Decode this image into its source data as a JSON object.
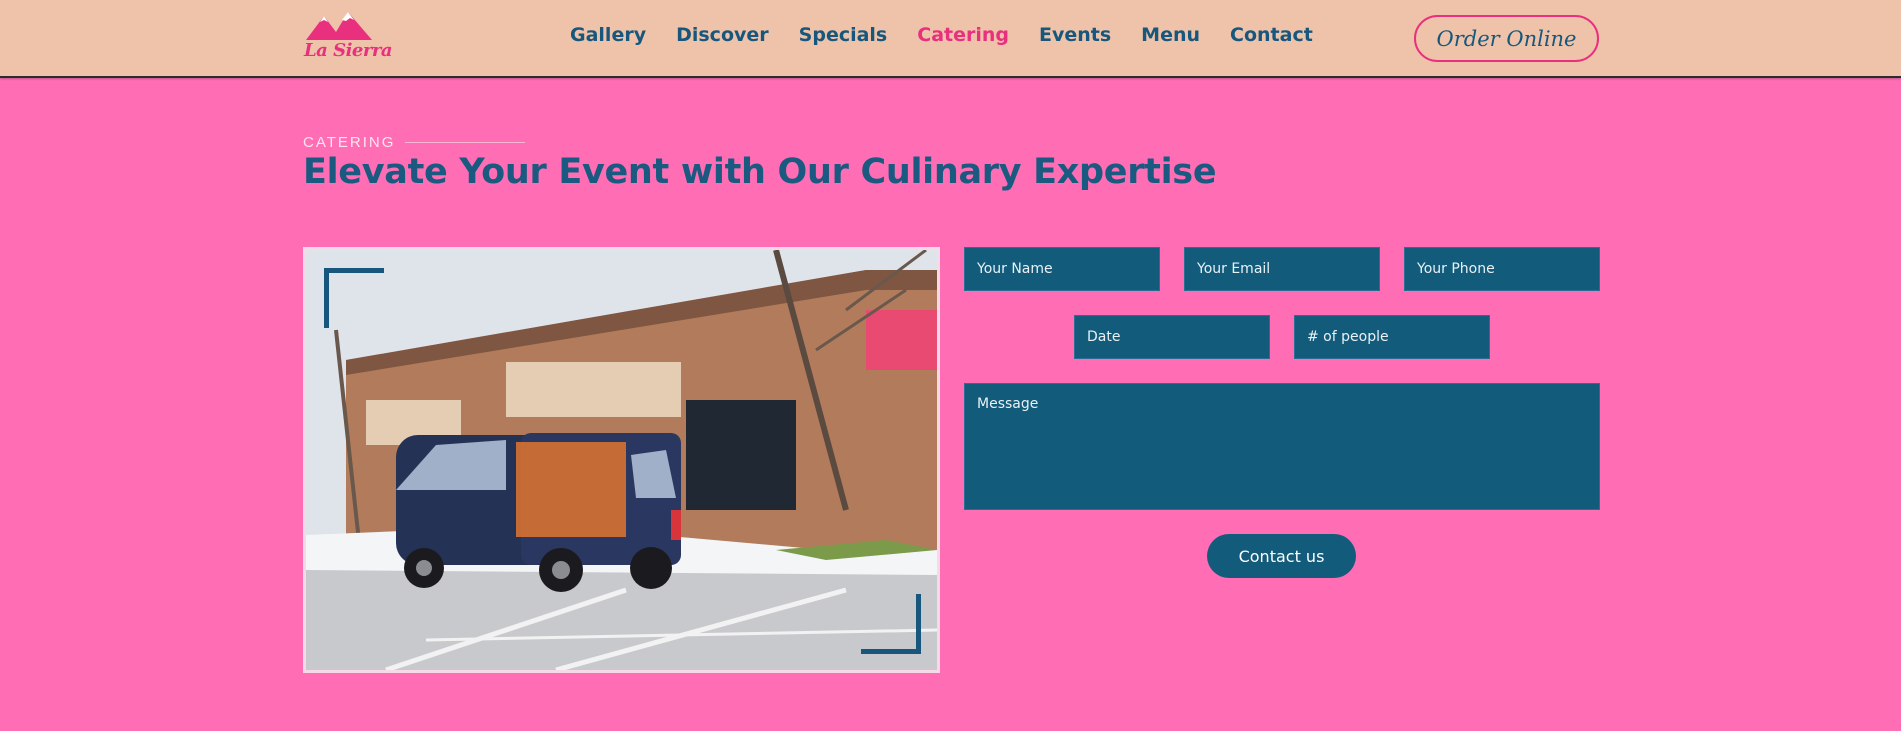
{
  "brand": {
    "logo_text": "La Sierra"
  },
  "nav": {
    "items": [
      {
        "label": "Gallery"
      },
      {
        "label": "Discover"
      },
      {
        "label": "Specials"
      },
      {
        "label": "Catering"
      },
      {
        "label": "Events"
      },
      {
        "label": "Menu"
      },
      {
        "label": "Contact"
      }
    ],
    "active": "Catering",
    "order_label": "Order Online"
  },
  "section": {
    "eyebrow": "CATERING",
    "headline": "Elevate Your Event with Our Culinary Expertise"
  },
  "form": {
    "name_placeholder": "Your Name",
    "email_placeholder": "Your Email",
    "phone_placeholder": "Your Phone",
    "date_placeholder": "Date",
    "people_placeholder": "# of people",
    "message_placeholder": "Message",
    "submit_label": "Contact us"
  },
  "colors": {
    "page_background": "#ff6eb4",
    "nav_background": "#eec3a9",
    "brand_pink": "#e8307e",
    "brand_blue": "#17577d",
    "field_background": "#125b7b"
  }
}
